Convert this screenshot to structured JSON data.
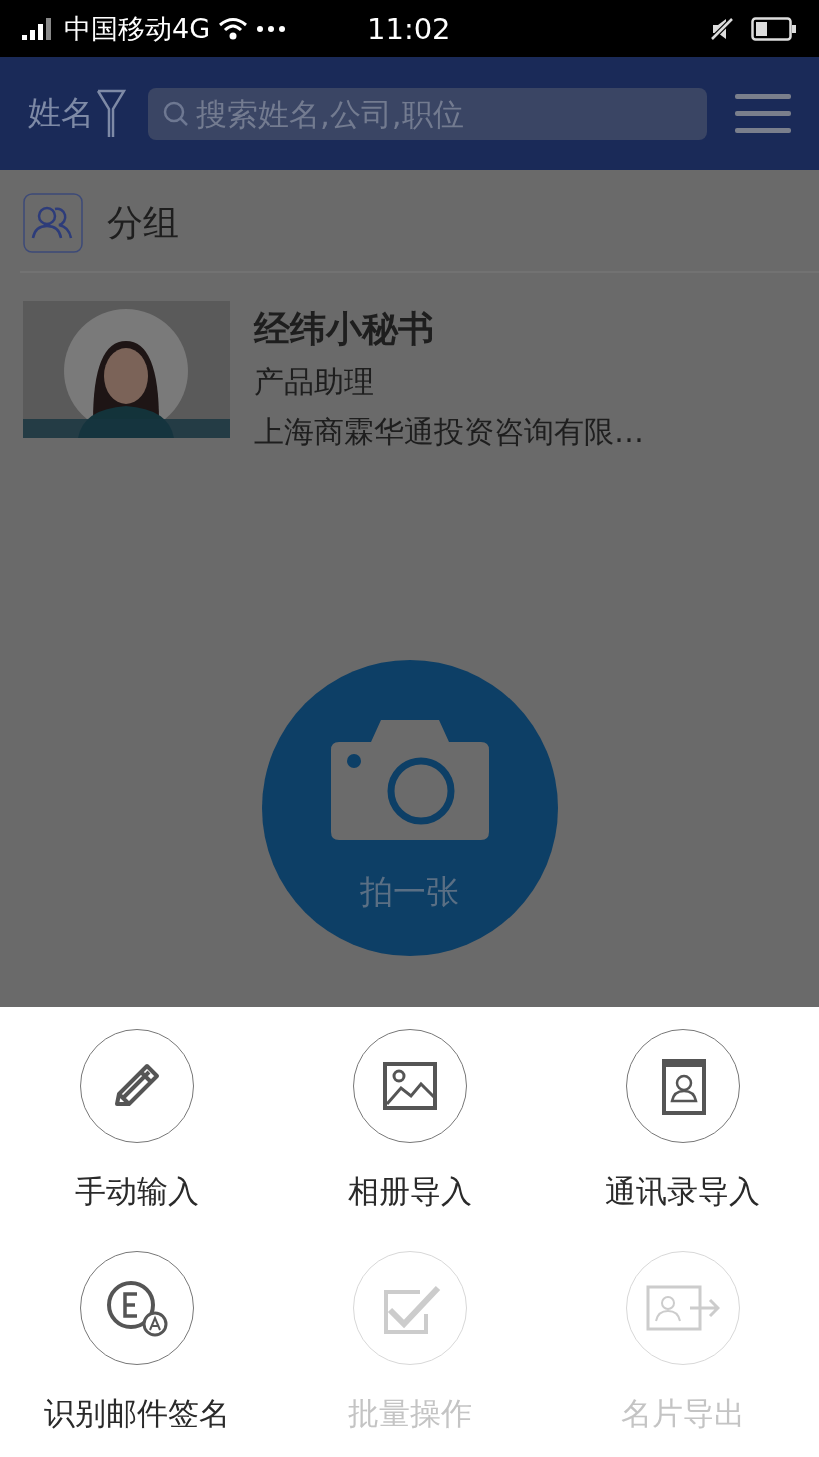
{
  "status_bar": {
    "carrier": "中国移动4G",
    "time": "11:02"
  },
  "header": {
    "filter_label": "姓名",
    "search": {
      "placeholder": "搜索姓名,公司,职位"
    }
  },
  "group": {
    "label": "分组"
  },
  "contacts": [
    {
      "name": "经纬小秘书",
      "title": "产品助理",
      "company": "上海商霖华通投资咨询有限…"
    }
  ],
  "camera_button": {
    "label": "拍一张"
  },
  "actions": [
    {
      "label": "手动输入",
      "kind": "pencil",
      "disabled": false
    },
    {
      "label": "相册导入",
      "kind": "album",
      "disabled": false
    },
    {
      "label": "通讯录导入",
      "kind": "contacts",
      "disabled": false
    },
    {
      "label": "识别邮件签名",
      "kind": "email",
      "disabled": false
    },
    {
      "label": "批量操作",
      "kind": "batch",
      "disabled": true
    },
    {
      "label": "名片导出",
      "kind": "export",
      "disabled": true
    }
  ]
}
